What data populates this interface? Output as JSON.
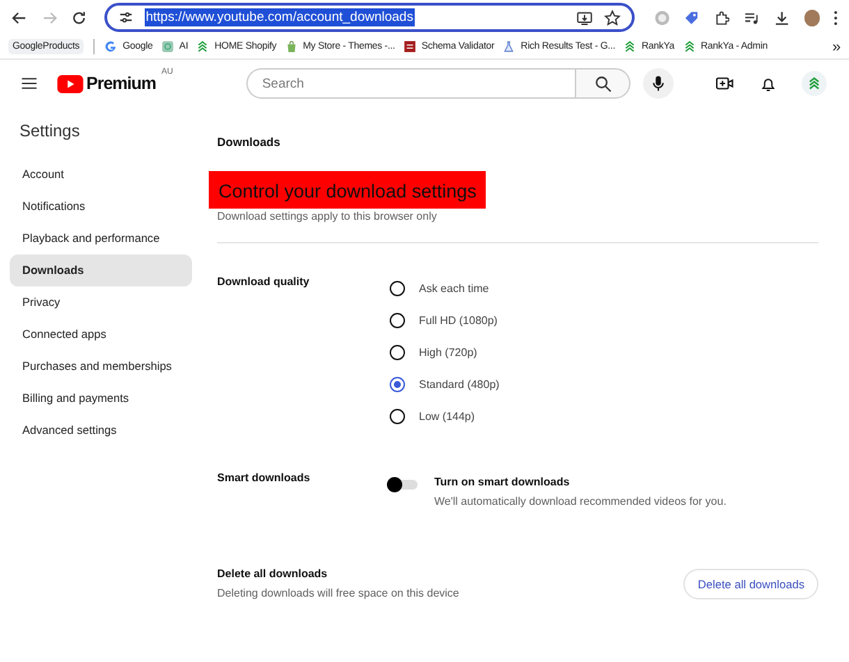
{
  "browser": {
    "url": "https://www.youtube.com/account_downloads",
    "url_selected": true,
    "forward_disabled": true
  },
  "bookmarks": [
    {
      "label": "GoogleProducts",
      "kind": "folder"
    },
    {
      "label": "Google",
      "kind": "google"
    },
    {
      "label": "AI",
      "kind": "ai"
    },
    {
      "label": "HOME Shopify",
      "kind": "chevrons"
    },
    {
      "label": "My Store - Themes -...",
      "kind": "bag"
    },
    {
      "label": "Schema Validator",
      "kind": "schema"
    },
    {
      "label": "Rich Results Test - G...",
      "kind": "flask"
    },
    {
      "label": "RankYa",
      "kind": "chevrons"
    },
    {
      "label": "RankYa - Admin",
      "kind": "chevrons"
    }
  ],
  "bookmarks_more": "»",
  "header": {
    "logo_text": "Premium",
    "region": "AU",
    "search_placeholder": "Search"
  },
  "sidebar": {
    "title": "Settings",
    "items": [
      {
        "label": "Account",
        "selected": false
      },
      {
        "label": "Notifications",
        "selected": false
      },
      {
        "label": "Playback and performance",
        "selected": false
      },
      {
        "label": "Downloads",
        "selected": true
      },
      {
        "label": "Privacy",
        "selected": false
      },
      {
        "label": "Connected apps",
        "selected": false
      },
      {
        "label": "Purchases and memberships",
        "selected": false
      },
      {
        "label": "Billing and payments",
        "selected": false
      },
      {
        "label": "Advanced settings",
        "selected": false
      }
    ]
  },
  "page": {
    "section": "Downloads",
    "heading": "Control your download settings",
    "heading_highlighted": true,
    "subheading": "Download settings apply to this browser only"
  },
  "quality": {
    "label": "Download quality",
    "options": [
      {
        "label": "Ask each time",
        "selected": false
      },
      {
        "label": "Full HD (1080p)",
        "selected": false
      },
      {
        "label": "High (720p)",
        "selected": false
      },
      {
        "label": "Standard (480p)",
        "selected": true
      },
      {
        "label": "Low (144p)",
        "selected": false
      }
    ]
  },
  "smart": {
    "label": "Smart downloads",
    "on": false,
    "title": "Turn on smart downloads",
    "description": "We'll automatically download recommended videos for you."
  },
  "delete": {
    "label": "Delete all downloads",
    "description": "Deleting downloads will free space on this device",
    "button": "Delete all downloads"
  }
}
